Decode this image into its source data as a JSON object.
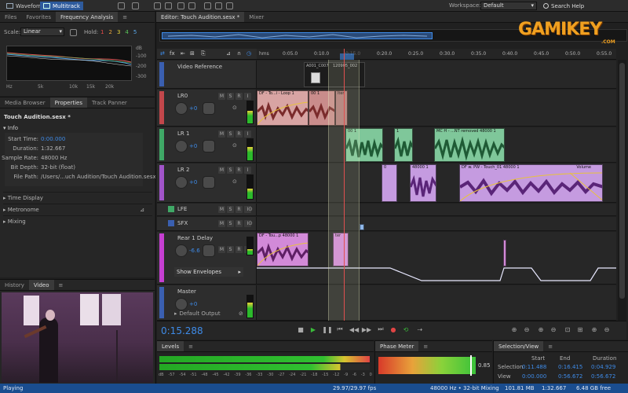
{
  "topbar": {
    "waveform": "Waveform",
    "multitrack": "Multitrack",
    "workspace_label": "Workspace:",
    "workspace_value": "Default",
    "search": "Search Help"
  },
  "left": {
    "tabs_top": [
      "Files",
      "Favorites",
      "Frequency Analysis"
    ],
    "scale_label": "Scale:",
    "scale_value": "Linear",
    "hold_label": "Hold:",
    "hold_values": [
      "1",
      "2",
      "3",
      "4",
      "5"
    ],
    "db_ticks": [
      "dB",
      "-100",
      "-200",
      "-300"
    ],
    "hz_ticks": [
      "Hz",
      "5k",
      "10k",
      "15k",
      "20k"
    ],
    "tabs_mid": [
      "Media Browser",
      "Properties",
      "Track Panner"
    ],
    "filename": "Touch Audition.sesx *",
    "info_label": "Info",
    "props": [
      {
        "k": "Start Time:",
        "v": "0:00.000"
      },
      {
        "k": "Duration:",
        "v": "1:32.667"
      },
      {
        "k": "Sample Rate:",
        "v": "48000 Hz"
      },
      {
        "k": "Bit Depth:",
        "v": "32-bit (float)"
      },
      {
        "k": "File Path:",
        "v": "/Users/...uch Audition/Touch Audition.sesx"
      }
    ],
    "sections": [
      "Time Display",
      "Metronome",
      "Mixing"
    ],
    "tabs_bottom": [
      "History",
      "Video"
    ]
  },
  "editor": {
    "tabs": [
      "Editor: Touch Audition.sesx *",
      "Mixer"
    ],
    "ruler_labels": [
      "hms",
      "0:05.0",
      "0:10.0",
      "0:15.0",
      "0:20.0",
      "0:25.0",
      "0:30.0",
      "0:35.0",
      "0:40.0",
      "0:45.0",
      "0:50.0",
      "0:55.0"
    ],
    "time_display": "0:15.288",
    "tracks": [
      {
        "name": "Video Reference",
        "color": "#3a5fb0"
      },
      {
        "name": "LR0",
        "color": "#c2474b",
        "vol": "+0"
      },
      {
        "name": "LR 1",
        "color": "#3fa866",
        "vol": "+0"
      },
      {
        "name": "LR 2",
        "color": "#a154c9",
        "vol": "+0"
      },
      {
        "name": "LFE",
        "color": "#3fa866"
      },
      {
        "name": "SFX",
        "color": "#3a5fb0"
      },
      {
        "name": "Rear 1 Delay",
        "color": "#c63fd2",
        "vol": "-6.6"
      },
      {
        "name": "Master",
        "color": "#3a5fb0",
        "vol": "+0"
      }
    ],
    "show_envelopes": "Show Envelopes",
    "default_output": "Default Output",
    "video_clip_labels": [
      "A001_C007",
      "120905_002"
    ],
    "clip_titles": {
      "lr0_a": "DF - To...i - Loop 1",
      "lr0_b": "00 1",
      "lr0_c": "lter",
      "lr1_a": "00 1",
      "lr1_b": "0 1",
      "lr1_c": "1",
      "lr1_d": "MC H - ...NT removed 48000 1",
      "lr2_a": "0",
      "lr2_b": "48000 1",
      "lr2_c": "DF w. PW - Touch_01 48000 1",
      "lr2_d": "Volume",
      "rear_a": "DF - Tou...p 48000 1",
      "rear_b": "ter"
    }
  },
  "bottom": {
    "levels_tab": "Levels",
    "level_ticks": [
      "dB",
      "-57",
      "-54",
      "-51",
      "-48",
      "-45",
      "-42",
      "-39",
      "-36",
      "-33",
      "-30",
      "-27",
      "-24",
      "-21",
      "-18",
      "-15",
      "-12",
      "-9",
      "-6",
      "-3",
      "0"
    ],
    "phase_tab": "Phase Meter",
    "phase_value": "0.85",
    "selview_tab": "Selection/View",
    "sel_headers": [
      "Start",
      "End",
      "Duration"
    ],
    "sel_rows": [
      {
        "label": "Selection",
        "start": "0:11.488",
        "end": "0:16.415",
        "dur": "0:04.929"
      },
      {
        "label": "View",
        "start": "0:00.000",
        "end": "0:56.672",
        "dur": "0:56.672"
      }
    ]
  },
  "status": {
    "left": "Playing",
    "fps": "29.97/29.97 fps",
    "rate": "48000 Hz • 32-bit Mixing",
    "mem": "101.81 MB",
    "dur": "1:32.667",
    "free": "6.48 GB free"
  },
  "watermark": {
    "text": "GAMIKEY",
    "sub": ".COM"
  },
  "colors": {
    "accent": "#3e8be8",
    "lr0": "#c2474b",
    "lr1": "#3fa866",
    "lr2": "#a154c9",
    "rear": "#c63fd2"
  }
}
